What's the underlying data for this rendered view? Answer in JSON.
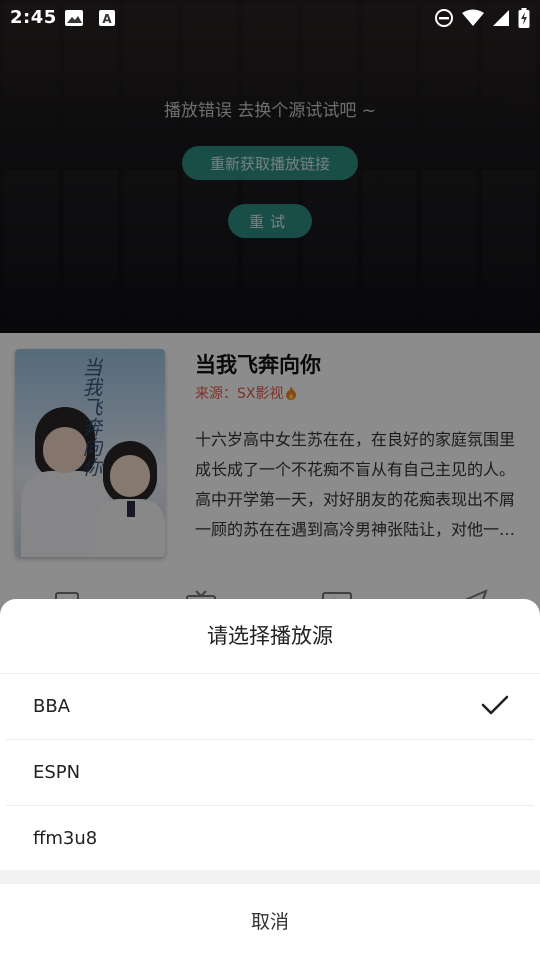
{
  "status_bar": {
    "time": "2:45",
    "left_icons": [
      "image-icon",
      "keyboard-icon"
    ],
    "right_icons": [
      "do-not-disturb-icon",
      "wifi-icon",
      "signal-icon",
      "battery-charging-icon"
    ]
  },
  "player": {
    "error_message": "播放错误 去换个源试试吧 ~",
    "refetch_label": "重新获取播放链接",
    "retry_label": "重试"
  },
  "movie": {
    "title": "当我飞奔向你",
    "source_label": "来源：SX影视",
    "source_icon": "flame-icon",
    "poster_text": "当我飞奔向你",
    "synopsis": "十六岁高中女生苏在在，在良好的家庭氛围里成长成了一个不花痴不盲从有自己主见的人。高中开学第一天，对好朋友的花痴表现出不屑一顾的苏在在遇到高冷男神张陆让，对他一见钟情……",
    "actions": [
      "download-icon",
      "tv-cast-icon",
      "screen-share-icon",
      "send-icon"
    ]
  },
  "sheet": {
    "title": "请选择播放源",
    "sources": [
      {
        "name": "BBA",
        "selected": true
      },
      {
        "name": "ESPN",
        "selected": false
      },
      {
        "name": "ffm3u8",
        "selected": false
      }
    ],
    "cancel_label": "取消"
  },
  "colors": {
    "accent": "#2f8f84",
    "source_red": "#e05a4a"
  }
}
